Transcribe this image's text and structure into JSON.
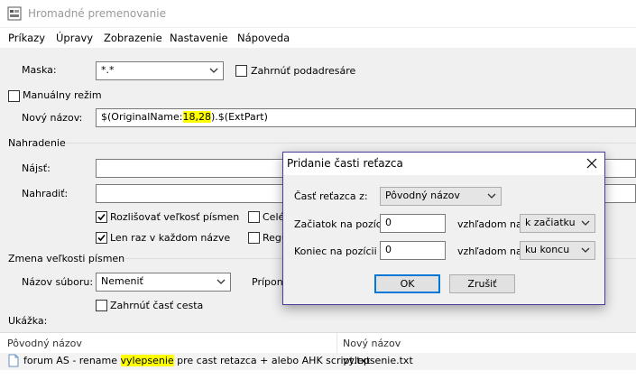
{
  "window": {
    "title": "Hromadné premenovanie"
  },
  "menu": [
    "Príkazy",
    "Úpravy",
    "Zobrazenie",
    "Nastavenie",
    "Nápoveda"
  ],
  "mask": {
    "label": "Maska:",
    "value": "*.*",
    "include_subdirs_label": "Zahrnúť podadresáre",
    "include_subdirs_checked": false
  },
  "manual_mode": {
    "label": "Manuálny režim",
    "checked": false
  },
  "new_name": {
    "label": "Nový názov:",
    "prefix": "$(OriginalName:",
    "highlight": "18,28",
    "suffix": ").$(ExtPart)"
  },
  "replace": {
    "section_label": "Nahradenie",
    "find_label": "Nájsť:",
    "find_value": "",
    "replace_label": "Nahradiť:",
    "replace_value": "",
    "case_sensitive_label": "Rozlišovať veľkosť písmen",
    "case_sensitive_checked": true,
    "whole_words_label": "Celé",
    "whole_words_checked": false,
    "once_label": "Len raz v každom názve",
    "once_checked": true,
    "regex_label": "Regu",
    "regex_checked": false
  },
  "case_change": {
    "section_label": "Zmena veľkosti písmen",
    "filename_label": "Názov súboru:",
    "filename_value": "Nemeniť",
    "extension_label": "Prípona",
    "include_path_label": "Zahrnúť časť cesta",
    "include_path_checked": false
  },
  "preview": {
    "label": "Ukážka:",
    "columns": [
      "Pôvodný názov",
      "Nový názov"
    ],
    "row": {
      "orig_prefix": "forum AS - rename ",
      "orig_highlight": "vylepsenie",
      "orig_suffix": " pre cast retazca + alebo AHK script.txt",
      "new_name": "vylepsenie.txt"
    }
  },
  "dialog": {
    "title": "Pridanie časti reťazca",
    "part_label": "Časť reťazca z:",
    "part_value": "Pôvodný názov",
    "start_label": "Začiatok na pozícii",
    "start_value": "0",
    "relative_label_1": "vzhľadom na",
    "relative_value_1": "k začiatku",
    "end_label": "Koniec na pozícii",
    "end_value": "0",
    "relative_label_2": "vzhľadom na",
    "relative_value_2": "ku koncu",
    "ok_label": "OK",
    "cancel_label": "Zrušiť"
  },
  "colors": {
    "accent": "#0078d7",
    "highlight": "#ffff00",
    "dialog_border": "#4b3a9a"
  },
  "icons": [
    "app-icon",
    "chevron-down-icon",
    "close-icon",
    "checkmark-icon",
    "file-icon"
  ]
}
